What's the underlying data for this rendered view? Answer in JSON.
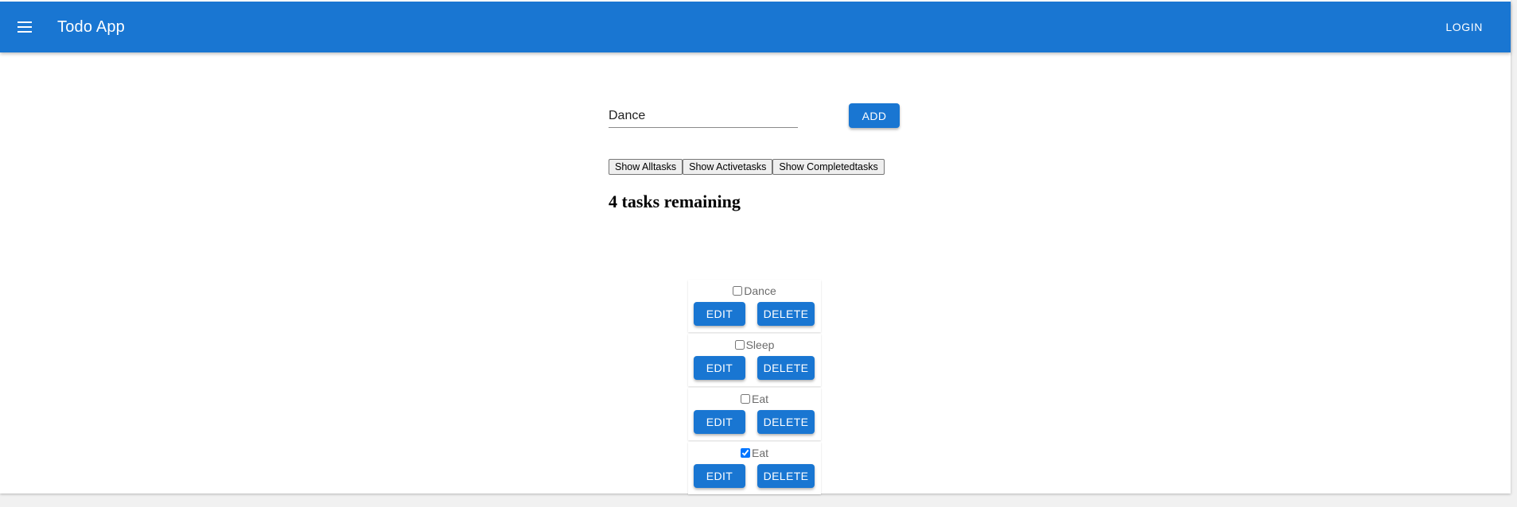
{
  "appbar": {
    "title": "Todo App",
    "menu_icon": "hamburger-menu-icon",
    "login_label": "LOGIN",
    "color": "#1976d2"
  },
  "form": {
    "input_value": "Dance",
    "add_label": "ADD"
  },
  "filters": {
    "all": "Show Alltasks",
    "active": "Show Activetasks",
    "completed": "Show Completedtasks"
  },
  "summary": {
    "remaining": "4 tasks remaining"
  },
  "tasks": [
    {
      "label": "Dance",
      "checked": false,
      "edit_label": "EDIT",
      "delete_label": "DELETE"
    },
    {
      "label": "Sleep",
      "checked": false,
      "edit_label": "EDIT",
      "delete_label": "DELETE"
    },
    {
      "label": "Eat",
      "checked": false,
      "edit_label": "EDIT",
      "delete_label": "DELETE"
    },
    {
      "label": "Eat",
      "checked": true,
      "edit_label": "EDIT",
      "delete_label": "DELETE"
    }
  ]
}
